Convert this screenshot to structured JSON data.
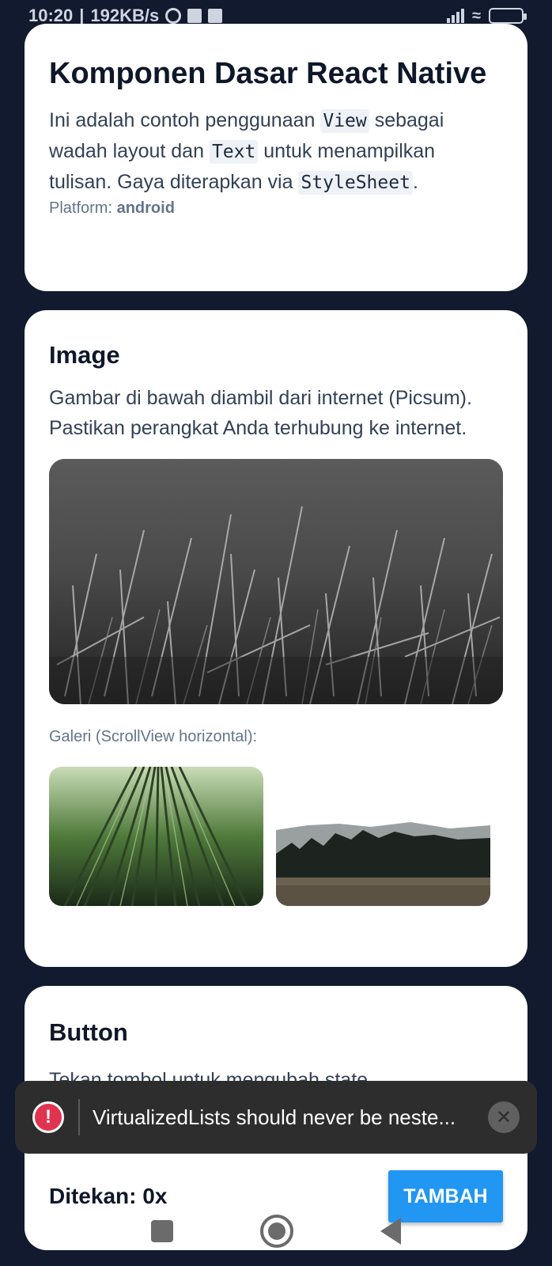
{
  "status_bar": {
    "time": "10:20",
    "speed": "192KB/s",
    "battery": "41"
  },
  "cards": {
    "intro": {
      "title": "Komponen Dasar React Native",
      "text_1": "Ini adalah contoh penggunaan ",
      "code_view": "View",
      "text_2": " sebagai wadah layout dan ",
      "code_text": "Text",
      "text_3": " untuk menampilkan tulisan. Gaya diterapkan via ",
      "code_stylesheet": "StyleSheet",
      "text_4": ".",
      "platform_label": "Platform: ",
      "platform_value": "android"
    },
    "image": {
      "title": "Image",
      "description": "Gambar di bawah diambil dari internet (Picsum). Pastikan perangkat Anda terhubung ke internet.",
      "gallery_label": "Galeri (ScrollView horizontal):"
    },
    "button": {
      "title": "Button",
      "description": "Tekan tombol untuk mengubah state",
      "counter": "Ditekan: 0x",
      "button_label": "TAMBAH"
    }
  },
  "toast": {
    "message": "VirtualizedLists should never be neste..."
  },
  "colors": {
    "background": "#111a2e",
    "card": "#ffffff",
    "accent": "#2196f3",
    "error": "#e0334f"
  }
}
